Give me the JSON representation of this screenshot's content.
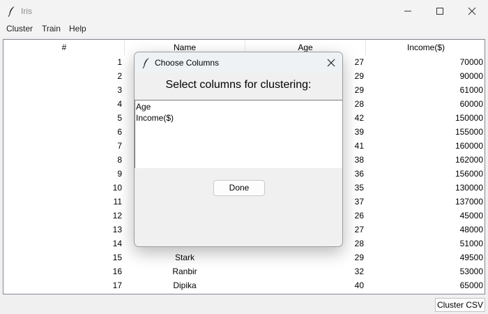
{
  "window": {
    "title": "Iris"
  },
  "menu": [
    "Cluster",
    "Train",
    "Help"
  ],
  "table": {
    "columns": [
      "#",
      "Name",
      "Age",
      "Income($)"
    ],
    "rows": [
      {
        "num": "1",
        "name": "",
        "age": "27",
        "income": "70000"
      },
      {
        "num": "2",
        "name": "",
        "age": "29",
        "income": "90000"
      },
      {
        "num": "3",
        "name": "",
        "age": "29",
        "income": "61000"
      },
      {
        "num": "4",
        "name": "",
        "age": "28",
        "income": "60000"
      },
      {
        "num": "5",
        "name": "",
        "age": "42",
        "income": "150000"
      },
      {
        "num": "6",
        "name": "",
        "age": "39",
        "income": "155000"
      },
      {
        "num": "7",
        "name": "",
        "age": "41",
        "income": "160000"
      },
      {
        "num": "8",
        "name": "",
        "age": "38",
        "income": "162000"
      },
      {
        "num": "9",
        "name": "",
        "age": "36",
        "income": "156000"
      },
      {
        "num": "10",
        "name": "",
        "age": "35",
        "income": "130000"
      },
      {
        "num": "11",
        "name": "",
        "age": "37",
        "income": "137000"
      },
      {
        "num": "12",
        "name": "",
        "age": "26",
        "income": "45000"
      },
      {
        "num": "13",
        "name": "",
        "age": "27",
        "income": "48000"
      },
      {
        "num": "14",
        "name": "",
        "age": "28",
        "income": "51000"
      },
      {
        "num": "15",
        "name": "Stark",
        "age": "29",
        "income": "49500"
      },
      {
        "num": "16",
        "name": "Ranbir",
        "age": "32",
        "income": "53000"
      },
      {
        "num": "17",
        "name": "Dipika",
        "age": "40",
        "income": "65000"
      }
    ]
  },
  "statusbar": {
    "cluster_button": "Cluster CSV"
  },
  "dialog": {
    "title": "Choose Columns",
    "heading": "Select columns for clustering:",
    "options": [
      "Age",
      "Income($)"
    ],
    "done_label": "Done"
  }
}
